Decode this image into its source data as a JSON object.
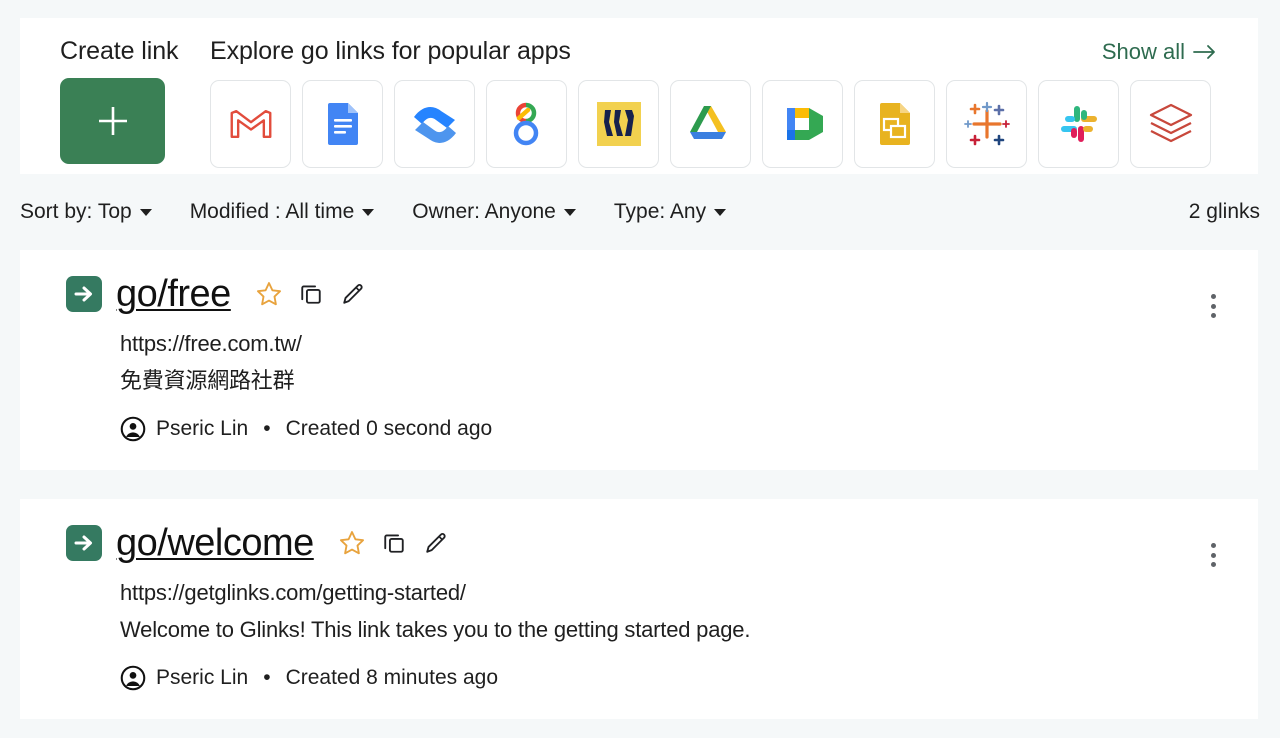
{
  "explore": {
    "create_label": "Create link",
    "create_button_icon": "plus-icon",
    "explore_title": "Explore go links for popular apps",
    "show_all_label": "Show all",
    "show_all_arrow": "→",
    "accent_green": "#3a8055",
    "link_green": "#2e6b4f",
    "apps": [
      {
        "name": "Gmail",
        "icon": "gmail-icon"
      },
      {
        "name": "Google Docs",
        "icon": "google-docs-icon"
      },
      {
        "name": "Confluence",
        "icon": "confluence-icon"
      },
      {
        "name": "Google Analytics",
        "icon": "google-analytics-icon"
      },
      {
        "name": "Miro",
        "icon": "miro-icon"
      },
      {
        "name": "Google Drive",
        "icon": "google-drive-icon"
      },
      {
        "name": "Google Meet",
        "icon": "google-meet-icon"
      },
      {
        "name": "Google Slides",
        "icon": "google-slides-icon"
      },
      {
        "name": "Tableau",
        "icon": "tableau-icon"
      },
      {
        "name": "Slack",
        "icon": "slack-icon"
      },
      {
        "name": "Databricks",
        "icon": "databricks-icon"
      }
    ]
  },
  "filters": {
    "items": [
      {
        "label": "Sort by: Top"
      },
      {
        "label": "Modified : All time"
      },
      {
        "label": "Owner: Anyone"
      },
      {
        "label": "Type: Any"
      }
    ],
    "count_label": "2 glinks"
  },
  "links": [
    {
      "title": "go/free",
      "url": "https://free.com.tw/",
      "description": "免費資源網路社群",
      "owner": "Pseric Lin",
      "separator": "•",
      "timestamp": "Created 0 second ago",
      "star_color": "#e8a33d"
    },
    {
      "title": "go/welcome",
      "url": "https://getglinks.com/getting-started/",
      "description": "Welcome to Glinks! This link takes you to the getting started page.",
      "owner": "Pseric Lin",
      "separator": "•",
      "timestamp": "Created 8 minutes ago",
      "star_color": "#e8a33d"
    }
  ]
}
